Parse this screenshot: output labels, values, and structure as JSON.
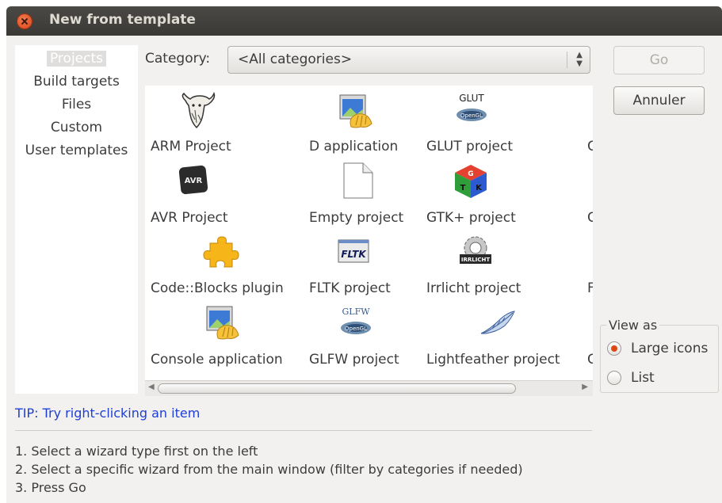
{
  "window": {
    "title": "New from template"
  },
  "sidebar": {
    "items": [
      {
        "label": "Projects",
        "selected": true
      },
      {
        "label": "Build targets"
      },
      {
        "label": "Files"
      },
      {
        "label": "Custom"
      },
      {
        "label": "User templates"
      }
    ]
  },
  "category": {
    "label": "Category:",
    "value": "<All categories>"
  },
  "templates": [
    {
      "label": "ARM Project",
      "icon": "gnu-icon"
    },
    {
      "label": "D application",
      "icon": "app-shell-icon"
    },
    {
      "label": "GLUT project",
      "icon": "glut-opengl-icon",
      "icon_text": "GLUT"
    },
    {
      "label": "AVR Project",
      "icon": "avr-chip-icon",
      "icon_text": "AVR"
    },
    {
      "label": "Empty project",
      "icon": "blank-file-icon"
    },
    {
      "label": "GTK+ project",
      "icon": "gtk-cube-icon",
      "icon_text": "GTK"
    },
    {
      "label": "Code::Blocks plugin",
      "icon": "puzzle-icon"
    },
    {
      "label": "FLTK project",
      "icon": "fltk-icon",
      "icon_text": "FLTK"
    },
    {
      "label": "Irrlicht project",
      "icon": "irrlicht-icon",
      "icon_text": "IRRLICHT"
    },
    {
      "label": "Console application",
      "icon": "app-shell-icon"
    },
    {
      "label": "GLFW project",
      "icon": "glfw-opengl-icon",
      "icon_text": "GLFW"
    },
    {
      "label": "Lightfeather project",
      "icon": "feather-icon"
    }
  ],
  "partial_column": [
    "C",
    "C",
    "C",
    "F",
    "C"
  ],
  "buttons": {
    "go": "Go",
    "cancel": "Annuler"
  },
  "view_as": {
    "legend": "View as",
    "large": "Large icons",
    "list": "List",
    "selected": "large"
  },
  "tip": "TIP: Try right-clicking an item",
  "instructions": [
    "1. Select a wizard type first on the left",
    "2. Select a specific wizard from the main window (filter by categories if needed)",
    "3. Press Go"
  ],
  "colors": {
    "titlebar": "#3d3c39",
    "tip": "#1d3fd6",
    "radio_on": "#dd4814"
  }
}
